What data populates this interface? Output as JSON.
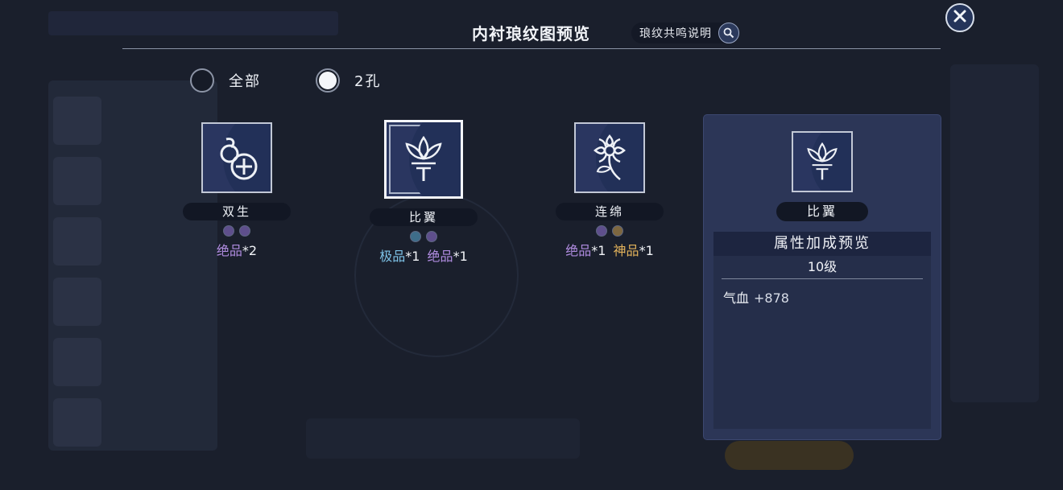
{
  "header": {
    "title": "内衬琅纹图预览",
    "help_label": "琅纹共鸣说明"
  },
  "filters": [
    {
      "label": "全部",
      "selected": false
    },
    {
      "label": "2孔",
      "selected": true
    }
  ],
  "cards": [
    {
      "name": "双生",
      "gems": [
        "#5e4f8c",
        "#5e4f8c"
      ],
      "grades": [
        {
          "text": "绝品",
          "count": "*2",
          "color": "#b08ce0"
        }
      ],
      "selected": false
    },
    {
      "name": "比翼",
      "gems": [
        "#3e6d8a",
        "#5e4f8c"
      ],
      "grades": [
        {
          "text": "极品",
          "count": "*1",
          "color": "#7ec3e8"
        },
        {
          "text": "绝品",
          "count": "*1",
          "color": "#b08ce0"
        }
      ],
      "selected": true
    },
    {
      "name": "连绵",
      "gems": [
        "#5e4f8c",
        "#7d6740"
      ],
      "grades": [
        {
          "text": "绝品",
          "count": "*1",
          "color": "#b08ce0"
        },
        {
          "text": "神品",
          "count": "*1",
          "color": "#e2b25b"
        }
      ],
      "selected": false
    }
  ],
  "detail": {
    "name": "比翼",
    "section_title": "属性加成预览",
    "level": "10级",
    "stats": [
      {
        "label": "气血",
        "value": "+878"
      }
    ]
  },
  "colors": {
    "panel": "#2c3657",
    "grade_purple": "#b08ce0",
    "grade_blue": "#7ec3e8",
    "grade_gold": "#e2b25b"
  }
}
